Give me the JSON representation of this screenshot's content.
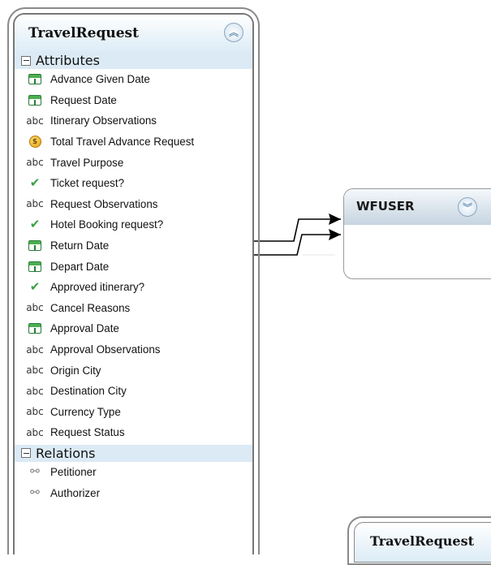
{
  "entity": {
    "title": "TravelRequest",
    "attributes_label": "Attributes",
    "relations_label": "Relations",
    "attributes": [
      {
        "label": "Advance Given Date",
        "icon": "calendar-icon"
      },
      {
        "label": "Request Date",
        "icon": "calendar-icon"
      },
      {
        "label": "Itinerary Observations",
        "icon": "abc-text-icon"
      },
      {
        "label": "Total Travel Advance Request",
        "icon": "currency-coin-icon"
      },
      {
        "label": "Travel Purpose",
        "icon": "abc-text-icon"
      },
      {
        "label": "Ticket request?",
        "icon": "checkmark-icon"
      },
      {
        "label": "Request Observations",
        "icon": "abc-text-icon"
      },
      {
        "label": "Hotel Booking request?",
        "icon": "checkmark-icon"
      },
      {
        "label": "Return Date",
        "icon": "calendar-icon"
      },
      {
        "label": "Depart Date",
        "icon": "calendar-icon"
      },
      {
        "label": "Approved itinerary?",
        "icon": "checkmark-icon"
      },
      {
        "label": "Cancel Reasons",
        "icon": "abc-text-icon"
      },
      {
        "label": "Approval Date",
        "icon": "calendar-icon"
      },
      {
        "label": "Approval Observations",
        "icon": "abc-text-icon"
      },
      {
        "label": "Origin City",
        "icon": "abc-text-icon"
      },
      {
        "label": "Destination City",
        "icon": "abc-text-icon"
      },
      {
        "label": "Currency Type",
        "icon": "abc-text-icon"
      },
      {
        "label": "Request Status",
        "icon": "abc-text-icon"
      }
    ],
    "relations": [
      {
        "label": "Petitioner",
        "icon": "relation-icon"
      },
      {
        "label": "Authorizer",
        "icon": "relation-icon"
      }
    ],
    "abc_glyph": "abc",
    "coin_glyph": "$",
    "check_glyph": "✔",
    "relation_glyph": "⚯",
    "collapse_glyph": "︽"
  },
  "wfuser": {
    "title": "WFUSER",
    "expand_glyph": "︾"
  },
  "second_entity": {
    "title": "TravelRequest"
  },
  "colors": {
    "header_blue": "#dbeaf5",
    "check_green": "#3aa142",
    "calendar_green": "#4caf50"
  }
}
